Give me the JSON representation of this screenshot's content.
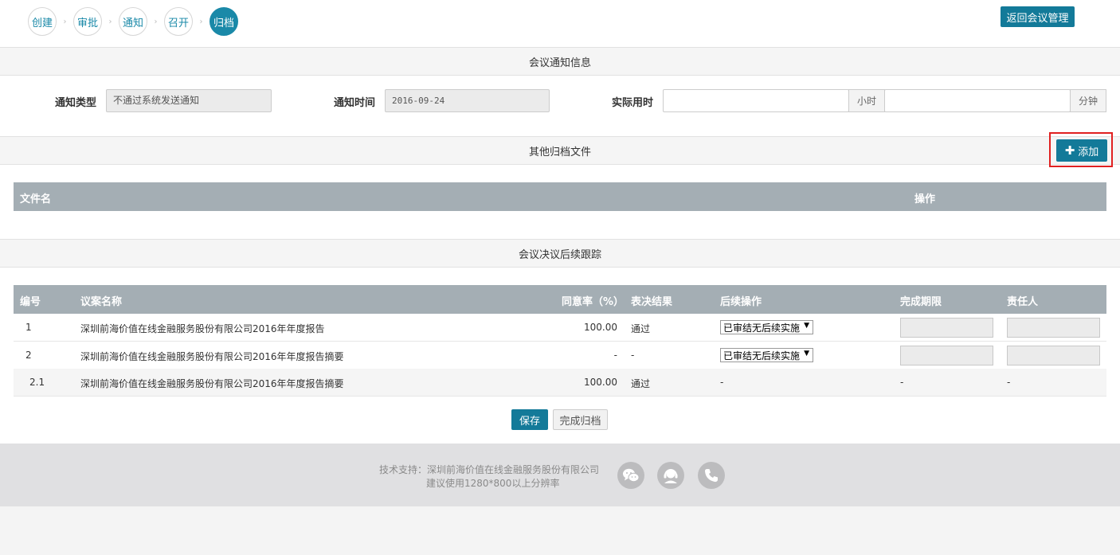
{
  "steps": [
    "创建",
    "审批",
    "通知",
    "召开",
    "归档"
  ],
  "header": {
    "back_label": "返回会议管理"
  },
  "notice_section": {
    "title": "会议通知信息",
    "type_label": "通知类型",
    "type_value": "不通过系统发送通知",
    "time_label": "通知时间",
    "time_value": "2016-09-24",
    "actual_label": "实际用时",
    "hours_value": "",
    "hours_unit": "小时",
    "minutes_value": "",
    "minutes_unit": "分钟"
  },
  "files_section": {
    "title": "其他归档文件",
    "add_label": "添加",
    "columns": [
      "文件名",
      "操作"
    ]
  },
  "tracking_section": {
    "title": "会议决议后续跟踪",
    "columns": [
      "编号",
      "议案名称",
      "同意率（%）",
      "表决结果",
      "后续操作",
      "完成期限",
      "责任人"
    ],
    "rows": [
      {
        "no": "1",
        "name": "深圳前海价值在线金融服务股份有限公司2016年年度报告",
        "rate": "100.00",
        "result": "通过",
        "action": "已审结无后续实施",
        "deadline": "",
        "owner": ""
      },
      {
        "no": "2",
        "name": "深圳前海价值在线金融服务股份有限公司2016年年度报告摘要",
        "rate": "-",
        "result": "-",
        "action": "已审结无后续实施",
        "deadline": "",
        "owner": ""
      },
      {
        "no": "2.1",
        "name": "深圳前海价值在线金融服务股份有限公司2016年年度报告摘要",
        "rate": "100.00",
        "result": "通过",
        "action": "-",
        "deadline": "-",
        "owner": "-"
      }
    ]
  },
  "buttons": {
    "save": "保存",
    "finish": "完成归档"
  },
  "footer": {
    "support": "技术支持：深圳前海价值在线金融服务股份有限公司",
    "resolution": "建议使用1280*800以上分辨率",
    "icons": [
      "wechat-icon",
      "customer-service-icon",
      "phone-icon"
    ]
  },
  "colors": {
    "primary": "#137a99",
    "table_header": "#a4aeb4",
    "highlight_border": "#e02020"
  }
}
